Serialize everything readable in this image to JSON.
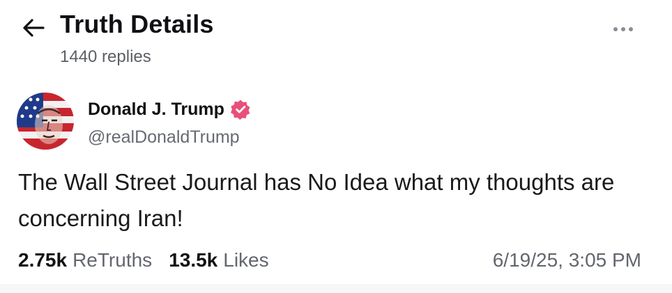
{
  "header": {
    "back_icon": "arrow-left-icon",
    "title": "Truth Details",
    "reply_count": "1440 replies",
    "more_icon": "more-horizontal-icon"
  },
  "post": {
    "author": {
      "name": "Donald J. Trump",
      "handle": "@realDonaldTrump",
      "verified": true,
      "verified_color": "#e8507a"
    },
    "text": "The Wall Street Journal has No Idea what my thoughts are concerning Iran!",
    "stats": {
      "retruths_count": "2.75k",
      "retruths_label": "ReTruths",
      "likes_count": "13.5k",
      "likes_label": "Likes"
    },
    "timestamp": "6/19/25, 3:05 PM"
  },
  "colors": {
    "text_primary": "#111111",
    "text_secondary": "#63666e",
    "accent_badge": "#e8507a"
  }
}
